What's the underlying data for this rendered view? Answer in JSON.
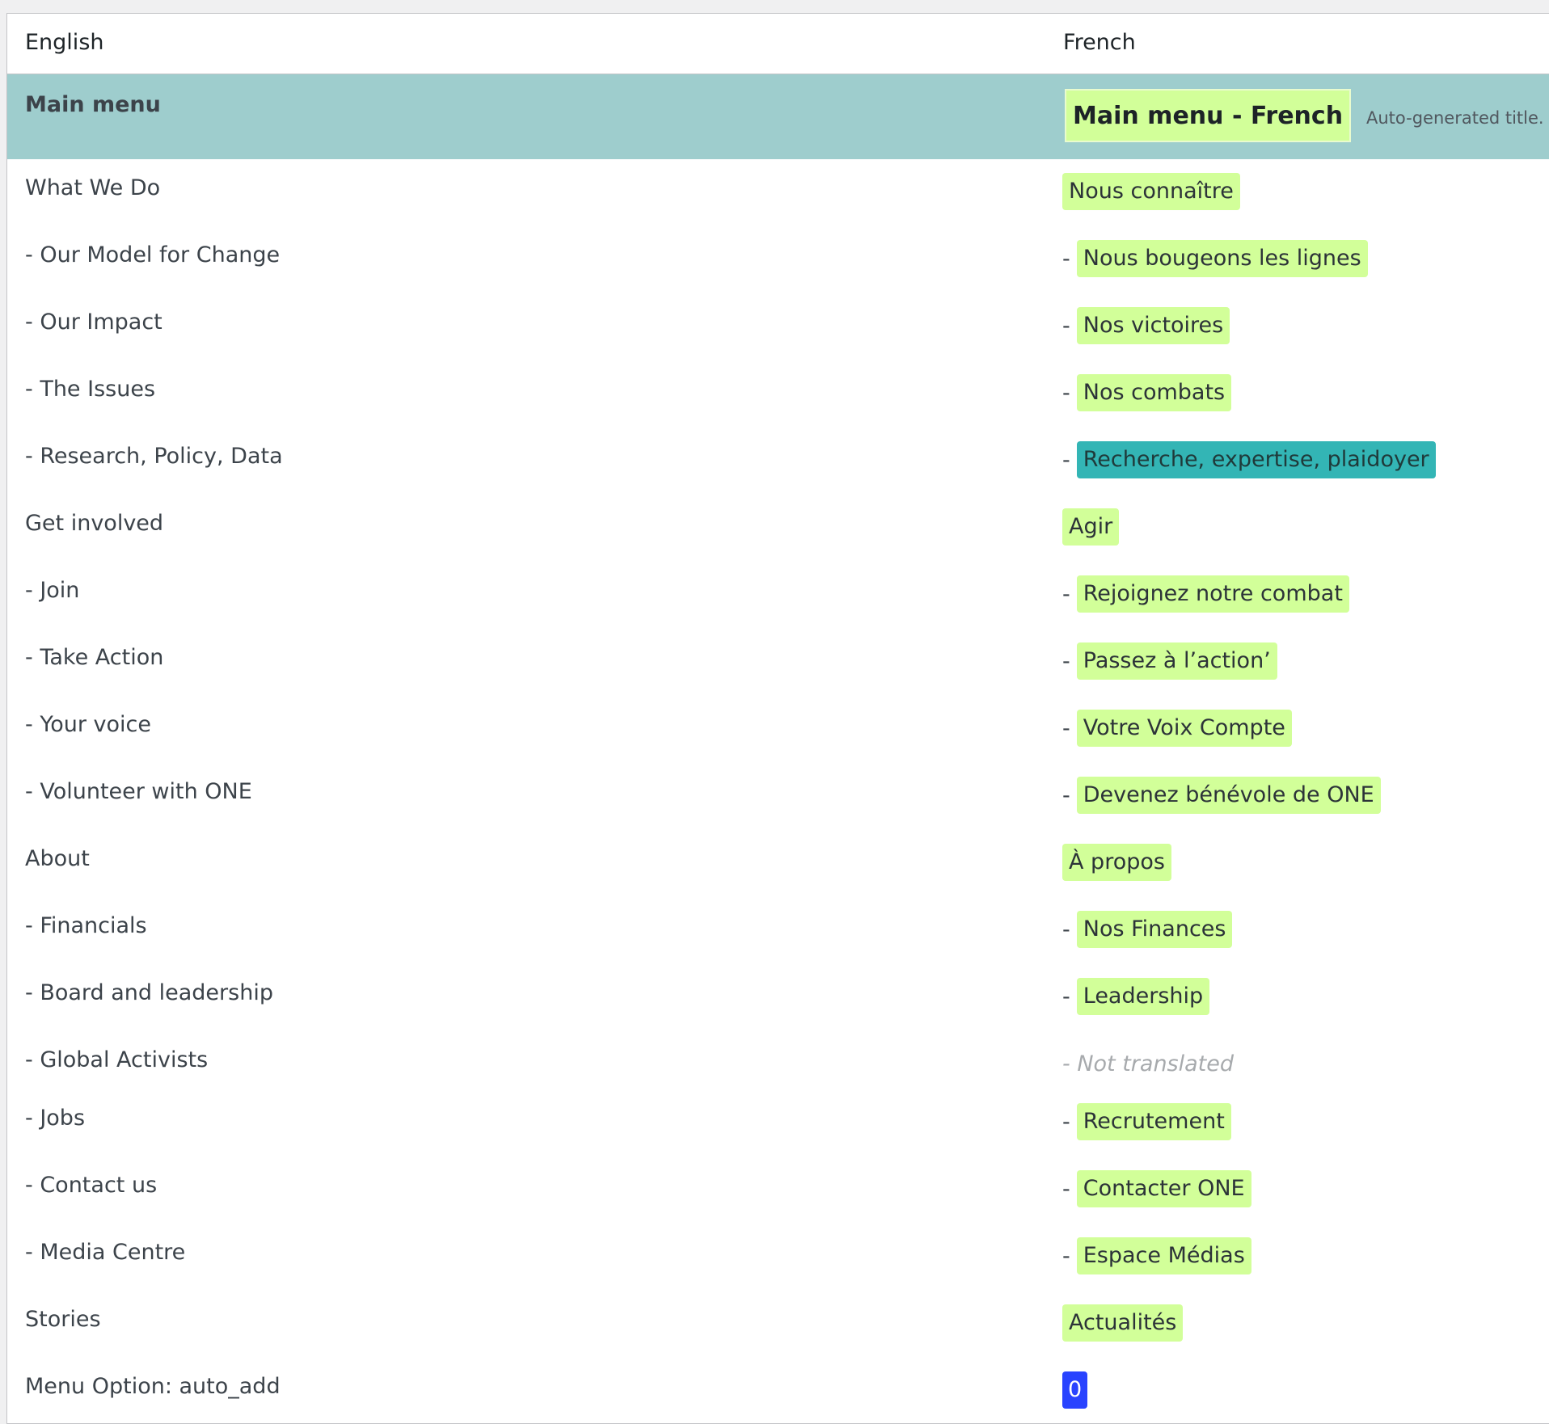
{
  "header": {
    "col_english": "English",
    "col_french": "French"
  },
  "title_row": {
    "english": "Main menu",
    "french_value": "Main menu - French",
    "note": "Auto-generated title. C"
  },
  "rows": [
    {
      "en": "What We Do",
      "dash": "",
      "fr": "Nous connaître"
    },
    {
      "en": "- Our Model for Change",
      "dash": "-",
      "fr": "Nous bougeons les lignes"
    },
    {
      "en": "- Our Impact",
      "dash": "-",
      "fr": "Nos victoires"
    },
    {
      "en": "- The Issues",
      "dash": "-",
      "fr": "Nos combats"
    },
    {
      "en": "- Research, Policy, Data",
      "dash": "-",
      "fr": "Recherche, expertise, plaidoyer"
    },
    {
      "en": "Get involved",
      "dash": "",
      "fr": "Agir"
    },
    {
      "en": "- Join",
      "dash": "-",
      "fr": "Rejoignez notre combat"
    },
    {
      "en": "- Take Action",
      "dash": "-",
      "fr": "Passez à l’action’"
    },
    {
      "en": "- Your voice",
      "dash": "-",
      "fr": "Votre Voix Compte"
    },
    {
      "en": "- Volunteer with ONE",
      "dash": "-",
      "fr": "Devenez bénévole de ONE"
    },
    {
      "en": "About",
      "dash": "",
      "fr": "À propos"
    },
    {
      "en": "- Financials",
      "dash": "-",
      "fr": "Nos Finances"
    },
    {
      "en": "- Board and leadership",
      "dash": "-",
      "fr": "Leadership"
    },
    {
      "en": "- Global Activists",
      "dash": "",
      "fr": "- Not translated"
    },
    {
      "en": "- Jobs",
      "dash": "-",
      "fr": "Recrutement"
    },
    {
      "en": "- Contact us",
      "dash": "-",
      "fr": "Contacter ONE"
    },
    {
      "en": "- Media Centre",
      "dash": "-",
      "fr": "Espace Médias"
    },
    {
      "en": "Stories",
      "dash": "",
      "fr": "Actualités"
    },
    {
      "en": "Menu Option: auto_add",
      "dash": "",
      "fr": "0"
    }
  ],
  "colors": {
    "title_row_bg": "#9ecdcd",
    "translated_chip": "#d2ff99",
    "selected_chip": "#33b5b5",
    "option_chip": "#2943ff"
  }
}
